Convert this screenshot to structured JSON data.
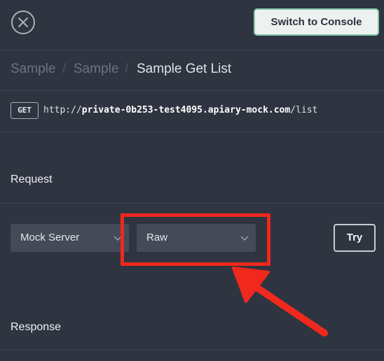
{
  "header": {
    "switch_console_label": "Switch to Console"
  },
  "breadcrumb": {
    "items": [
      "Sample",
      "Sample",
      "Sample Get List"
    ],
    "separator": "/"
  },
  "endpoint": {
    "method": "GET",
    "url_prefix": "http://",
    "url_host": "private-0b253-test4095.apiary-mock.com",
    "url_path": "/list"
  },
  "request": {
    "title": "Request",
    "server_select": "Mock Server",
    "format_select": "Raw",
    "try_label": "Try"
  },
  "response": {
    "title": "Response"
  },
  "annotation": {
    "color": "#f0281d"
  },
  "colors": {
    "background": "#2f3441",
    "select_bg": "#444a57",
    "console_border": "#87c7ad"
  }
}
